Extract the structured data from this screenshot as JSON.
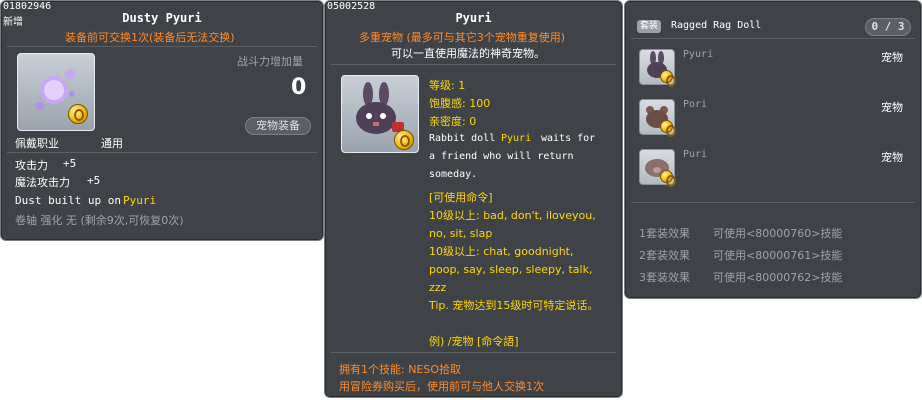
{
  "left": {
    "id": "01802946",
    "tag": "新增",
    "title": "Dusty Pyuri",
    "trade_note": "装备前可交换1次(装备后无法交换)",
    "power_label": "战斗力增加量",
    "power_value": "0",
    "equip_btn": "宠物装备",
    "job_label": "佩戴职业",
    "job_value": "通用",
    "stats": [
      {
        "label": "攻击力",
        "value": "+5"
      },
      {
        "label": "魔法攻击力",
        "value": "+5"
      }
    ],
    "desc_prefix": "Dust built up on",
    "desc_name": "Pyuri",
    "scroll_line": "卷轴 强化 无 (剩余9次,可恢复0次)"
  },
  "middle": {
    "id": "05002528",
    "title": "Pyuri",
    "subtitle": "多重宠物 (最多可与其它3个宠物重复使用)",
    "subtitle2": "可以一直使用魔法的神奇宠物。",
    "level": "等级: 1",
    "fullness": "饱腹感: 100",
    "closeness": "亲密度: 0",
    "desc": [
      "Rabbit doll",
      "Pyuri",
      "waits for",
      "a friend who will return",
      "someday."
    ],
    "cmd_header": "[可使用命令]",
    "cmd_lines": [
      "10级以上: bad, don't, iloveyou, no, sit, slap",
      "10级以上: chat, goodnight, poop, say, sleep, sleepy, talk, zzz"
    ],
    "tip": "Tip. 宠物达到15级时可特定说话。",
    "example": "例) /宠物 [命令語]",
    "skill": "拥有1个技能: NESO拾取",
    "trade": "用冒险券购买后，使用前可与他人交换1次"
  },
  "right": {
    "set_badge": "套装",
    "set_name": "Ragged Rag Doll",
    "count": "0 / 3",
    "items": [
      {
        "name": "Pyuri",
        "type": "宠物"
      },
      {
        "name": "Pori",
        "type": "宠物"
      },
      {
        "name": "Puri",
        "type": "宠物"
      }
    ],
    "effects": [
      {
        "label": "1套装效果",
        "value": "可使用<80000760>技能"
      },
      {
        "label": "2套装效果",
        "value": "可使用<80000761>技能"
      },
      {
        "label": "3套装效果",
        "value": "可使用<80000762>技能"
      }
    ]
  }
}
